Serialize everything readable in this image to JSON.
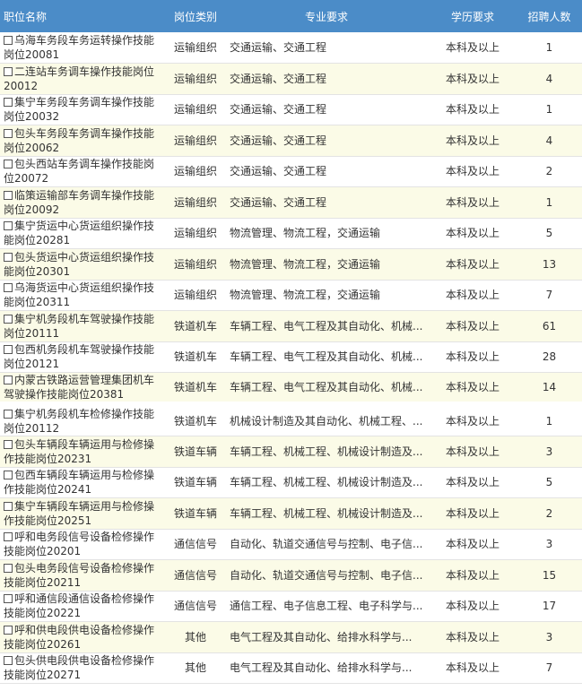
{
  "header": {
    "col_name": "职位名称",
    "col_type": "岗位类别",
    "col_major": "专业要求",
    "col_edu": "学历要求",
    "col_count": "招聘人数"
  },
  "rows": [
    {
      "name_l1": "乌海车务段车务运转操作技能",
      "name_l2": "岗位20081",
      "type": "运输组织",
      "major": "交通运输、交通工程",
      "edu": "本科及以上",
      "count": "1"
    },
    {
      "name_l1": "二连站车务调车操作技能岗位",
      "name_l2": "20012",
      "type": "运输组织",
      "major": "交通运输、交通工程",
      "edu": "本科及以上",
      "count": "4"
    },
    {
      "name_l1": "集宁车务段车务调车操作技能",
      "name_l2": "岗位20032",
      "type": "运输组织",
      "major": "交通运输、交通工程",
      "edu": "本科及以上",
      "count": "1"
    },
    {
      "name_l1": "包头车务段车务调车操作技能",
      "name_l2": "岗位20062",
      "type": "运输组织",
      "major": "交通运输、交通工程",
      "edu": "本科及以上",
      "count": "4"
    },
    {
      "name_l1": "包头西站车务调车操作技能岗",
      "name_l2": "位20072",
      "type": "运输组织",
      "major": "交通运输、交通工程",
      "edu": "本科及以上",
      "count": "2"
    },
    {
      "name_l1": "临策运输部车务调车操作技能",
      "name_l2": "岗位20092",
      "type": "运输组织",
      "major": "交通运输、交通工程",
      "edu": "本科及以上",
      "count": "1"
    },
    {
      "name_l1": "集宁货运中心货运组织操作技",
      "name_l2": "能岗位20281",
      "type": "运输组织",
      "major": "物流管理、物流工程，交通运输",
      "edu": "本科及以上",
      "count": "5"
    },
    {
      "name_l1": "包头货运中心货运组织操作技",
      "name_l2": "能岗位20301",
      "type": "运输组织",
      "major": "物流管理、物流工程，交通运输",
      "edu": "本科及以上",
      "count": "13"
    },
    {
      "name_l1": "乌海货运中心货运组织操作技",
      "name_l2": "能岗位20311",
      "type": "运输组织",
      "major": "物流管理、物流工程，交通运输",
      "edu": "本科及以上",
      "count": "7"
    },
    {
      "name_l1": "集宁机务段机车驾驶操作技能",
      "name_l2": "岗位20111",
      "type": "铁道机车",
      "major": "车辆工程、电气工程及其自动化、机械...",
      "edu": "本科及以上",
      "count": "61"
    },
    {
      "name_l1": "包西机务段机车驾驶操作技能",
      "name_l2": "岗位20121",
      "type": "铁道机车",
      "major": "车辆工程、电气工程及其自动化、机械...",
      "edu": "本科及以上",
      "count": "28"
    },
    {
      "name_l1": "内蒙古铁路运营管理集团机车",
      "name_l2": "驾驶操作技能岗位20381",
      "type": "铁道机车",
      "major": "车辆工程、电气工程及其自动化、机械...",
      "edu": "本科及以上",
      "count": "14"
    },
    {
      "name_l1": "集宁机务段机车检修操作技能",
      "name_l2": "岗位20112",
      "type": "铁道机车",
      "major": "机械设计制造及其自动化、机械工程、...",
      "edu": "本科及以上",
      "count": "1"
    },
    {
      "name_l1": "包头车辆段车辆运用与检修操",
      "name_l2": "作技能岗位20231",
      "type": "铁道车辆",
      "major": "车辆工程、机械工程、机械设计制造及...",
      "edu": "本科及以上",
      "count": "3"
    },
    {
      "name_l1": "包西车辆段车辆运用与检修操",
      "name_l2": "作技能岗位20241",
      "type": "铁道车辆",
      "major": "车辆工程、机械工程、机械设计制造及...",
      "edu": "本科及以上",
      "count": "5"
    },
    {
      "name_l1": "集宁车辆段车辆运用与检修操",
      "name_l2": "作技能岗位20251",
      "type": "铁道车辆",
      "major": "车辆工程、机械工程、机械设计制造及...",
      "edu": "本科及以上",
      "count": "2"
    },
    {
      "name_l1": "呼和电务段信号设备检修操作",
      "name_l2": "技能岗位20201",
      "type": "通信信号",
      "major": "自动化、轨道交通信号与控制、电子信...",
      "edu": "本科及以上",
      "count": "3"
    },
    {
      "name_l1": "包头电务段信号设备检修操作",
      "name_l2": "技能岗位20211",
      "type": "通信信号",
      "major": "自动化、轨道交通信号与控制、电子信...",
      "edu": "本科及以上",
      "count": "15"
    },
    {
      "name_l1": "呼和通信段通信设备检修操作",
      "name_l2": "技能岗位20221",
      "type": "通信信号",
      "major": "通信工程、电子信息工程、电子科学与...",
      "edu": "本科及以上",
      "count": "17"
    },
    {
      "name_l1": "呼和供电段供电设备检修操作",
      "name_l2": "技能岗位20261",
      "type": "其他",
      "major": "电气工程及其自动化、给排水科学与...",
      "edu": "本科及以上",
      "count": "3"
    },
    {
      "name_l1": "包头供电段供电设备检修操作",
      "name_l2": "技能岗位20271",
      "type": "其他",
      "major": "电气工程及其自动化、给排水科学与...",
      "edu": "本科及以上",
      "count": "7"
    }
  ],
  "colors": {
    "header_bg": "#4b8cc8",
    "row_alt_bg": "#fbfbe7"
  }
}
